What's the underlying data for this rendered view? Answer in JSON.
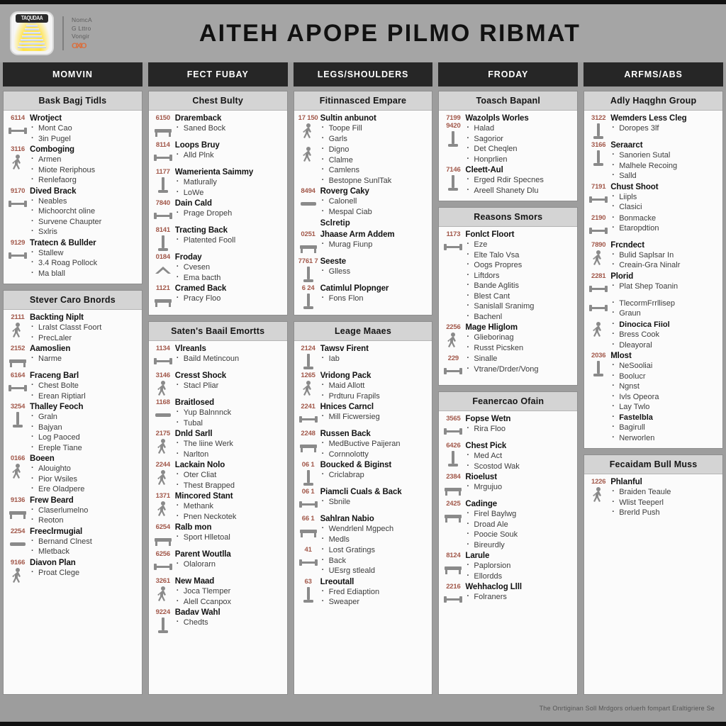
{
  "masthead": {
    "logo_label": "TAQUDAA",
    "logo_icon": "stairs-glow-logo-icon",
    "brand_lines": [
      "NomcA",
      "G Lttro",
      "Vongir"
    ],
    "brand_dots": "OXIO",
    "title": "AITEH APOPE PILMO RIBMAT"
  },
  "day_tabs": [
    {
      "label": "MOMVIN"
    },
    {
      "label": "FECT FUBAY"
    },
    {
      "label": "LEGS/SHOULDERS"
    },
    {
      "label": "FRODAY"
    },
    {
      "label": "ARFMS/ABS"
    }
  ],
  "footer": {
    "text": "The Onrtiginan Soll Mrdgors orluerh fompart Eraltigriere Se"
  },
  "accent_colors": {
    "code": "#a2584a",
    "tab_bg": "#262626",
    "card_head_bg": "#d4d4d4",
    "poster_bg": "#9d9d9d",
    "icon": "#8a8a8a"
  },
  "columns": [
    {
      "cards": [
        {
          "title": "Bask Bagj Tidls",
          "groups": [
            {
              "code": "6114",
              "icon": "barbell-row-icon",
              "title": "Wrotject",
              "items": [
                "Mont Cao",
                "3in Pugel"
              ]
            },
            {
              "code": "3116",
              "icon": "athlete-kick-icon",
              "title": "Comboging",
              "items": [
                "Armen",
                "Miote Reriphous",
                "Renlefaorg"
              ]
            },
            {
              "code": "9170",
              "icon": "dumbbell-press-icon",
              "title": "Dived Brack",
              "items": [
                "Neables",
                "Michoorcht oline",
                "Survene Chaupter",
                "Sxlris"
              ]
            },
            {
              "code": "9129",
              "icon": "curl-bar-icon",
              "title": "Tratecn & Bullder",
              "items": [
                "Stallew",
                "3.4 Roag Pollock",
                "Ma blall"
              ]
            }
          ]
        },
        {
          "title": "Stever Caro Bnords",
          "groups": [
            {
              "code": "2111",
              "icon": "lunge-figure-icon",
              "title": "Backting Niplt",
              "items": [
                "Lralst Classt Foort",
                "PrecLaler"
              ]
            },
            {
              "code": "2152",
              "icon": "bench-flat-icon",
              "title": "Aamoslien",
              "items": [
                "Narme"
              ]
            },
            {
              "code": "6164",
              "icon": "kettlebell-icon",
              "title": "Fraceng Barl",
              "items": [
                "Chest Bolte",
                "Erean Riptiarl"
              ]
            },
            {
              "code": "3254",
              "icon": "cable-machine-icon",
              "title": "Thalley Feoch",
              "items": [
                "Graln",
                "Bajyan",
                "Log Paoced",
                "Ereple Tiane"
              ]
            },
            {
              "code": "0166",
              "icon": "overhead-reach-icon",
              "title": "Boeen",
              "items": [
                "Alouighto",
                "Pior Wsiles",
                "Ere Oladpere"
              ]
            },
            {
              "code": "9136",
              "icon": "bench-press-icon",
              "title": "Frew Beard",
              "items": [
                "Claserlumelno",
                "Reoton"
              ]
            },
            {
              "code": "2254",
              "icon": "step-box-icon",
              "title": "Freeclrmugial",
              "items": [
                "Bernand Clnest",
                "Mletback"
              ]
            },
            {
              "code": "9166",
              "icon": "runner-icon",
              "title": "Diavon Plan",
              "items": [
                "Proat Clege"
              ]
            }
          ]
        }
      ]
    },
    {
      "cards": [
        {
          "title": "Chest Bulty",
          "groups": [
            {
              "code": "6150",
              "icon": "incline-bench-icon",
              "title": "Draremback",
              "items": [
                "Saned Bock"
              ]
            },
            {
              "code": "8114",
              "icon": "dumbbell-single-icon",
              "title": "Loops Bruy",
              "items": [
                "Alld Plnk"
              ]
            },
            {
              "code": "1177",
              "icon": "rowing-machine-icon",
              "title": "Wamerienta Saimmy",
              "items": [
                "Matlurally",
                "LoWe"
              ]
            },
            {
              "code": "7840",
              "icon": "weight-plate-icon",
              "title": "Dain Cald",
              "items": [
                "Prage Dropeh"
              ]
            },
            {
              "code": "8141",
              "icon": "pull-handle-icon",
              "title": "Tracting Back",
              "items": [
                "Platented Fooll"
              ]
            },
            {
              "code": "0184",
              "icon": "chevron-up-icon",
              "title": "Froday",
              "items": [
                "Cvesen",
                "Ema bacth"
              ]
            },
            {
              "code": "1121",
              "icon": "flat-bench-icon",
              "title": "Cramed Back",
              "items": [
                "Pracy Floo"
              ]
            }
          ]
        },
        {
          "title": "Saten's Baail Emortts",
          "groups": [
            {
              "code": "1134",
              "icon": "swoosh-bar-icon",
              "title": "Vlreanls",
              "items": [
                "Baild Metincoun"
              ]
            },
            {
              "code": "3146",
              "icon": "squat-rack-icon",
              "title": "Cresst Shock",
              "items": [
                "Stacl Pliar"
              ]
            },
            {
              "code": "1168",
              "icon": "bent-row-icon",
              "title": "Braitlosed",
              "items": [
                "Yup Balnnnck",
                "Tubal"
              ]
            },
            {
              "code": "2175",
              "icon": "arms-up-figure-icon",
              "title": "Dnld Sarll",
              "items": [
                "The liine Werk",
                "Narlton"
              ]
            },
            {
              "code": "2244",
              "icon": "raise-figure-icon",
              "title": "Lackain Nolo",
              "items": [
                "Oter Cliat",
                "Thest Brapped"
              ]
            },
            {
              "code": "1371",
              "icon": "standing-press-icon",
              "title": "Mincored Stant",
              "items": [
                "Methank",
                "Pnen Neckotek"
              ]
            },
            {
              "code": "6254",
              "icon": "bar-bench-icon",
              "title": "Ralb mon",
              "items": [
                "Sport Hlletoal"
              ]
            },
            {
              "code": "6256",
              "icon": "straight-bar-icon",
              "title": "Parent Woutlla",
              "items": [
                "Olalorarn"
              ]
            },
            {
              "code": "3261",
              "icon": "seated-row-figure-icon",
              "title": "New Maad",
              "items": [
                "Joca Tlemper",
                "Alell Ccanpox"
              ]
            },
            {
              "code": "9224",
              "icon": "legs-stance-icon",
              "title": "Badav Wahl",
              "items": [
                "Chedts"
              ]
            }
          ]
        }
      ]
    },
    {
      "cards": [
        {
          "title": "Fitinnasced Empare",
          "groups": [
            {
              "code": "17 150",
              "icon": "squat-figure-icon",
              "title": "Sultin anbunot",
              "items": [
                "Toope Fill",
                "Garls"
              ]
            },
            {
              "code": "",
              "icon": "kick-figure-icon",
              "title": "",
              "items": [
                "Digno",
                "Clalme",
                "Camlens",
                "Bestopne SunlTak"
              ]
            },
            {
              "code": "8494",
              "icon": "leg-curl-icon",
              "title": "Roverg Caky",
              "items": [
                "Calonell",
                "Mespal Ciab"
              ]
            },
            {
              "code": "",
              "icon": "",
              "note": "Sclretip",
              "items": []
            },
            {
              "code": "0251",
              "icon": "ab-bench-icon",
              "title": "Jhaase Arm Addem",
              "items": [
                "Murag Fiunp"
              ]
            },
            {
              "code": "7761 7",
              "icon": "scale-block-icon",
              "title": "Seeste",
              "items": [
                "Glless"
              ]
            },
            {
              "code": "6 24",
              "icon": "press-sled-icon",
              "title": "Catimlul Plopnger",
              "items": [
                "Fons Flon"
              ]
            }
          ]
        },
        {
          "title": "Leage Maaes",
          "groups": [
            {
              "code": "2124",
              "icon": "triangle-frame-icon",
              "title": "Tawsv Firent",
              "items": [
                "Iab"
              ]
            },
            {
              "code": "1265",
              "icon": "kneeling-figure-icon",
              "title": "Vridong Pack",
              "items": [
                "Maid Allott",
                "Prdturu Frapils"
              ]
            },
            {
              "code": "2241",
              "icon": "vertical-bar-icon",
              "title": "Hnices Carncl",
              "items": [
                "Mill Ficwersieg"
              ]
            },
            {
              "code": "2248",
              "icon": "bench-long-icon",
              "title": "Russen Back",
              "items": [
                "MedBuctive Paijeran",
                "Cornnolotty"
              ]
            },
            {
              "code": "06 1",
              "icon": "two-legs-icon",
              "title": "Boucked & Biginst",
              "items": [
                "Criclabrap"
              ]
            },
            {
              "code": "06 1",
              "icon": "dual-weight-icon",
              "title": "Piamcli Cuals & Back",
              "items": [
                "Sbnile"
              ]
            },
            {
              "code": "66 1",
              "icon": "slab-bar-icon",
              "title": "Sahlran Nabio",
              "items": [
                "Wendrlenl Mgpech",
                "Medls"
              ]
            },
            {
              "code": "41",
              "icon": "bottle-weight-icon",
              "title": "",
              "items": [
                "Lost Gratings",
                "Back",
                "UEsrg stleald"
              ]
            },
            {
              "code": "63",
              "icon": "legs-pair-icon",
              "title": "Lreoutall",
              "items": [
                "Fred Ediaption",
                "Sweaper"
              ]
            }
          ]
        }
      ]
    },
    {
      "cards": [
        {
          "title": "Toasch Bapanl",
          "groups": [
            {
              "code": "7199",
              "icon": "seated-machine-icon",
              "title": "Wazolpls Worles",
              "items": [
                "Halad",
                "Sagorior",
                "Det Cheqlen",
                "Honprlien"
              ],
              "subcode": "9420"
            },
            {
              "code": "7146",
              "icon": "leg-press-icon",
              "title": "Cleett-Aul",
              "items": [
                "Erged Rdir Specnes",
                "Areell Shanety Dlu"
              ]
            }
          ]
        },
        {
          "title": "Reasons Smors",
          "groups": [
            {
              "code": "1173",
              "icon": "angled-bar-icon",
              "title": "Fonlct Floort",
              "items": [
                "Eze",
                "Elte Talo Vsa",
                "Oogs Propres",
                "Liftdors",
                "Bande Aglitis",
                "Blest Cant",
                "Sanislall Sranimg",
                "Bachenl"
              ]
            },
            {
              "code": "2256",
              "icon": "standing-figure-icon",
              "title": "Mage Hliglom",
              "items": [
                "Glieborinag",
                "Russt Picsken"
              ]
            },
            {
              "code": "229",
              "icon": "hook-weight-icon",
              "title": "",
              "items": [
                "Sinalle",
                "Vtrane/Drder/Vong"
              ]
            }
          ]
        },
        {
          "title": "Feanercao Ofain",
          "groups": [
            {
              "code": "3565",
              "icon": "pin-weight-icon",
              "title": "Fopse Wetn",
              "items": [
                "Rira Floo"
              ]
            },
            {
              "code": "6426",
              "icon": "fly-machine-icon",
              "title": "Chest Pick",
              "items": [
                "Med Act",
                "Scostod Wak"
              ]
            },
            {
              "code": "2384",
              "icon": "bench-segmented-icon",
              "title": "Rioelust",
              "items": [
                "Mrgujuo"
              ]
            },
            {
              "code": "2425",
              "icon": "incline-slab-icon",
              "title": "Cadinge",
              "items": [
                "Firel Baylwg",
                "Droad Ale",
                "Poocie Souk",
                "Bireurdly"
              ]
            },
            {
              "code": "8124",
              "icon": "split-bench-icon",
              "title": "Larule",
              "items": [
                "Paplorsion",
                "Ellordds"
              ]
            },
            {
              "code": "2216",
              "icon": "curve-bar-icon",
              "title": "Wehhaclog Llll",
              "items": [
                "Folraners"
              ]
            }
          ]
        }
      ]
    },
    {
      "cards": [
        {
          "title": "Adly Haqghn Group",
          "groups": [
            {
              "code": "3122",
              "icon": "legs-short-icon",
              "title": "Wemders Less Cleg",
              "items": [
                "Doropes 3lf"
              ]
            },
            {
              "code": "3166",
              "icon": "burst-bowl-icon",
              "title": "Seraarct",
              "items": [
                "Sanorien Sutal",
                "Malhele Recoing",
                "Salld"
              ]
            },
            {
              "code": "7191",
              "icon": "diagonal-bar-icon",
              "title": "Chust Shoot",
              "items": [
                "Liipls",
                "Clasici"
              ]
            },
            {
              "code": "2190",
              "icon": "slash-bar-icon",
              "title": "",
              "items": [
                "Bonmacke",
                "Etaropdtion"
              ]
            },
            {
              "code": "7890",
              "icon": "raised-arms-icon",
              "title": "Frcndect",
              "items": [
                "Bulid Saplsar In",
                "Creain-Gra Ninalr"
              ]
            },
            {
              "code": "2281",
              "icon": "plate-stack-icon",
              "title": "Plorid",
              "items": [
                "Plat Shep Toanin"
              ]
            },
            {
              "code": "",
              "icon": "bird-swoosh-icon",
              "title": "",
              "items": [
                "TlecormFrrllisep",
                "Graun"
              ]
            },
            {
              "code": "",
              "icon": "bent-over-figure-icon",
              "title": "",
              "items": [
                "Dinocica Fiiol",
                "Bress Cook",
                "Dleayoral"
              ],
              "bold_first": true
            },
            {
              "code": "2036",
              "icon": "cable-tower-icon",
              "title": "Mlost",
              "items": [
                "NeSooliai",
                "Boolucr",
                "Ngnst",
                "Ivls Opeora",
                "Lay Twlo",
                "Fastelbla",
                "Bagirull",
                "Nerworlen"
              ],
              "bold_index": 5
            }
          ]
        },
        {
          "title": "Fecaidam Bull Muss",
          "groups": [
            {
              "code": "1226",
              "icon": "victory-figure-icon",
              "title": "Phlanful",
              "items": [
                "Braiden Teaule",
                "Wlist Teeperl",
                "Brerld Push"
              ]
            }
          ]
        }
      ]
    }
  ]
}
